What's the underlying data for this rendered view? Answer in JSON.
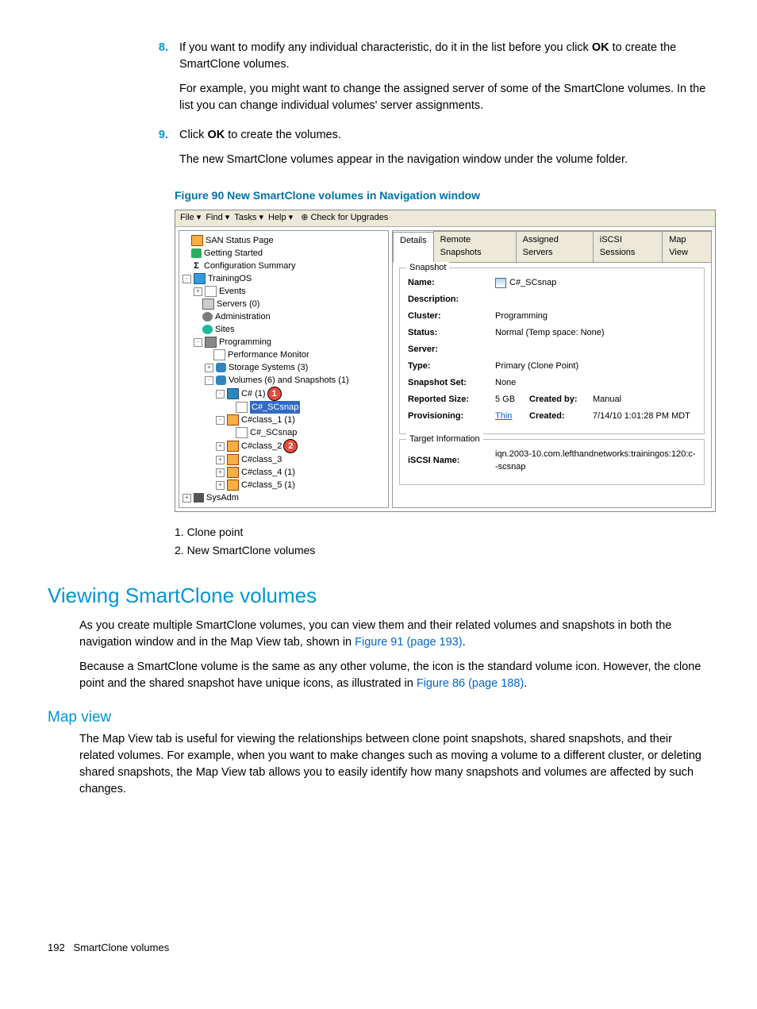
{
  "steps": {
    "8": {
      "num": "8.",
      "p1_a": "If you want to modify any individual characteristic, do it in the list before you click ",
      "p1_b": "OK",
      "p1_c": " to create the SmartClone volumes.",
      "p2": "For example, you might want to change the assigned server of some of the SmartClone volumes. In the list you can change individual volumes' server assignments."
    },
    "9": {
      "num": "9.",
      "p1_a": "Click ",
      "p1_b": "OK",
      "p1_c": " to create the volumes.",
      "p2": "The new SmartClone volumes appear in the navigation window under the volume folder."
    }
  },
  "figure_title": "Figure 90 New SmartClone volumes in Navigation window",
  "screenshot": {
    "menu": {
      "file": "File",
      "find": "Find",
      "tasks": "Tasks",
      "help": "Help",
      "check": "Check for Upgrades"
    },
    "tree": {
      "root1": "SAN Status Page",
      "root2": "Getting Started",
      "root3": "Configuration Summary",
      "trainingos": "TrainingOS",
      "events": "Events",
      "servers": "Servers (0)",
      "admin": "Administration",
      "sites": "Sites",
      "programming": "Programming",
      "perfmon": "Performance Monitor",
      "storage": "Storage Systems (3)",
      "vols": "Volumes (6) and Snapshots (1)",
      "c1": "C# (1)",
      "c1snap": "C#_SCsnap",
      "cc1": "C#class_1 (1)",
      "cc1snap": "C#_SCsnap",
      "cc2": "C#class_2",
      "cc3": "C#class_3",
      "cc4": "C#class_4 (1)",
      "cc5": "C#class_5 (1)",
      "sysadm": "SysAdm",
      "callout1": "1",
      "callout2": "2"
    },
    "tabs": {
      "details": "Details",
      "remote": "Remote Snapshots",
      "assigned": "Assigned Servers",
      "iscsi": "iSCSI Sessions",
      "map": "Map View"
    },
    "fs1_legend": "Snapshot",
    "fs2_legend": "Target Information",
    "fields": {
      "name_k": "Name:",
      "name_v": "C#_SCsnap",
      "desc_k": "Description:",
      "desc_v": "",
      "cluster_k": "Cluster:",
      "cluster_v": "Programming",
      "status_k": "Status:",
      "status_v": "Normal (Temp space: None)",
      "server_k": "Server:",
      "server_v": "",
      "type_k": "Type:",
      "type_v": "Primary (Clone Point)",
      "set_k": "Snapshot Set:",
      "set_v": "None",
      "size_k": "Reported Size:",
      "size_v": "5 GB",
      "createdby_k": "Created by:",
      "createdby_v": "Manual",
      "prov_k": "Provisioning:",
      "prov_v": "Thin",
      "created_k": "Created:",
      "created_v": "7/14/10 1:01:28 PM MDT",
      "iscsi_k": "iSCSI Name:",
      "iscsi_v": "iqn.2003-10.com.lefthandnetworks:trainingos:120:c--scsnap"
    }
  },
  "captions": {
    "c1": "1. Clone point",
    "c2": "2. New SmartClone volumes"
  },
  "section1": {
    "title": "Viewing SmartClone volumes",
    "p1_a": "As you create multiple SmartClone volumes, you can view them and their related volumes and snapshots in both the navigation window and in the Map View tab, shown in ",
    "p1_link": "Figure 91 (page 193)",
    "p1_b": ".",
    "p2_a": "Because a SmartClone volume is the same as any other volume, the icon is the standard volume icon. However, the clone point and the shared snapshot have unique icons, as illustrated in ",
    "p2_link": "Figure 86 (page 188)",
    "p2_b": "."
  },
  "section2": {
    "title": "Map view",
    "p1": "The Map View tab is useful for viewing the relationships between clone point snapshots, shared snapshots, and their related volumes. For example, when you want to make changes such as moving a volume to a different cluster, or deleting shared snapshots, the Map View tab allows you to easily identify how many snapshots and volumes are affected by such changes."
  },
  "footer": {
    "page": "192",
    "title": "SmartClone volumes"
  }
}
